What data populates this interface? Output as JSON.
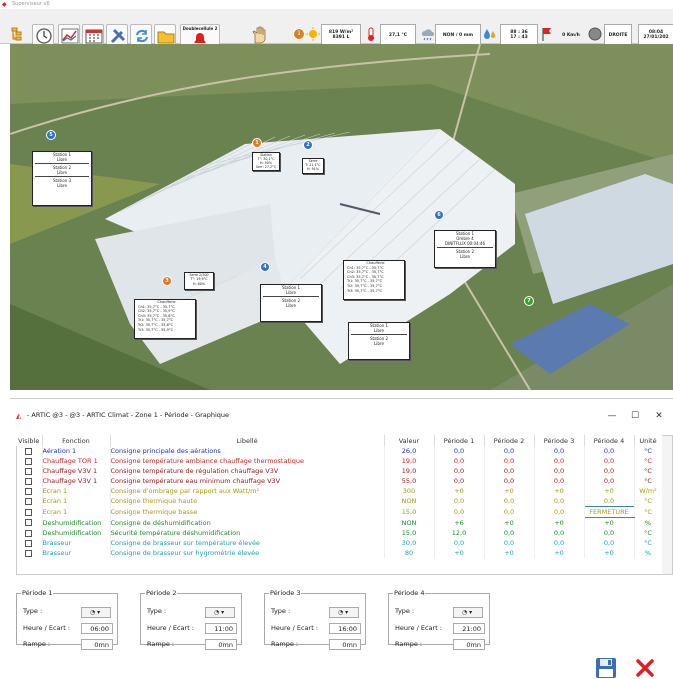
{
  "top_window": {
    "title": "Superviseur v6"
  },
  "toolbar": {
    "alarm_label": "Doublecellule 2",
    "weather": {
      "radiation": "819 W/m²\n8391 L",
      "temperature": "27,1 °C",
      "rain": "NON / 0 mm",
      "humidity": "88 : 36\n17 : 43",
      "wind_speed": "0 Km/h",
      "wind_dir": "DROITE",
      "datetime": "08:04\n27/01/202"
    }
  },
  "map": {
    "pins": [
      {
        "num": "5",
        "color": "#2f6fd0"
      },
      {
        "num": "1",
        "color": "#e07b1b"
      },
      {
        "num": "2",
        "color": "#2f6fd0"
      },
      {
        "num": "6",
        "color": "#2f6fd0"
      },
      {
        "num": "4",
        "color": "#2f6fd0"
      },
      {
        "num": "3",
        "color": "#e07b1b"
      },
      {
        "num": "7",
        "color": "#3aa02a"
      }
    ],
    "boxes": [
      {
        "lines": [
          "Station 1",
          "Libre",
          "",
          "Station 2",
          "Libre",
          "",
          "Station 3",
          "Libre"
        ]
      },
      {
        "lines": [
          "Station",
          "T°: 20,1°C",
          "H: 90%",
          "Serr: 27,2°C"
        ]
      },
      {
        "lines": [
          "Serre",
          "T: 21,1°C",
          "H: 91%"
        ]
      },
      {
        "lines": [
          "Station 1",
          "Ombre 4",
          "DINITFLUX 00:04:46",
          "",
          "Station 2",
          "Libre"
        ]
      },
      {
        "lines": [
          "Chaufferie",
          "Ch1: 35,7°C - 35,7°C",
          "Ch2: 35,7°C - 35,7°C",
          "Ch3: 35,7°C - 35,7°C",
          "Tr1: 35,7°C - 35,7°C",
          "Tr2: 35,7°C - 35,7°C",
          "Tr3: 35,7°C - 35,7°C"
        ]
      },
      {
        "lines": [
          "Station 1",
          "Libre",
          "",
          "Station 2",
          "Libre"
        ]
      },
      {
        "lines": [
          "Serre 2/300",
          "T°: 19,9°C",
          "H: 80%"
        ]
      },
      {
        "lines": [
          "Chaufferie",
          "Ch1: 35,7°C - 35,7°C",
          "Ch2: 35,7°C - 35,9°C",
          "Ch3: 35,7°C - 35,8°C",
          "Tr1: 35,7°C - 35,7°C",
          "Tr2: 35,7°C - 35,8°C",
          "Tr3: 35,7°C - 35,9°C"
        ]
      },
      {
        "lines": [
          "Station 1",
          "Libre",
          "",
          "Station 2",
          "Libre"
        ]
      }
    ]
  },
  "dialog": {
    "title": "- ARTIC @3 - @3 - ARTIC Climat - Zone 1 - Période - Graphique",
    "buttons": {
      "minimize": "—",
      "maximize": "☐",
      "close": "✕"
    },
    "columns": [
      "Visible",
      "Fonction",
      "Libellé",
      "Valeur",
      "Période 1",
      "Période 2",
      "Période 3",
      "Période 4",
      "Unité"
    ],
    "rows": [
      {
        "fonction": "Aération 1",
        "libelle": "Consigne principale des aérations",
        "valeur": "26,0",
        "p1": "0,0",
        "p2": "0,0",
        "p3": "0,0",
        "p4": "0,0",
        "unite": "°C",
        "color": "#1a2fd8"
      },
      {
        "fonction": "Chauffage TOR 1",
        "libelle": "Consigne température ambiance chauffage thermostatique",
        "valeur": "19,0",
        "p1": "0,0",
        "p2": "0,0",
        "p3": "0,0",
        "p4": "0,0",
        "unite": "°C",
        "color": "#d81a1a"
      },
      {
        "fonction": "Chauffage V3V 1",
        "libelle": "Consigne température de régulation chauffage V3V",
        "valeur": "19,0",
        "p1": "0,0",
        "p2": "0,0",
        "p3": "0,0",
        "p4": "0,0",
        "unite": "°C",
        "color": "#a01818"
      },
      {
        "fonction": "Chauffage V3V 1",
        "libelle": "Consigne température eau minimum chauffage V3V",
        "valeur": "55,0",
        "p1": "0,0",
        "p2": "0,0",
        "p3": "0,0",
        "p4": "0,0",
        "unite": "°C",
        "color": "#a01818"
      },
      {
        "fonction": "Ecran 1",
        "libelle": "Consigne d'ombrage par rapport aux Watt/m²",
        "valeur": "300",
        "p1": "+0",
        "p2": "+0",
        "p3": "+0",
        "p4": "+0",
        "unite": "W/m²",
        "color": "#a89a10"
      },
      {
        "fonction": "Ecran 1",
        "libelle": "Consigne thermique haute",
        "valeur": "NON",
        "p1": "0,0",
        "p2": "0,0",
        "p3": "0,0",
        "p4": "0,0",
        "unite": "°C",
        "color": "#a89a10"
      },
      {
        "fonction": "Ecran 1",
        "libelle": "Consigne thermique basse",
        "valeur": "15,0",
        "p1": "0,0",
        "p2": "0,0",
        "p3": "0,0",
        "p4": "FERMETURE",
        "unite": "°C",
        "color": "#a89a10"
      },
      {
        "fonction": "Deshumidification",
        "libelle": "Consigne de déshumidification",
        "valeur": "NON",
        "p1": "+6",
        "p2": "+0",
        "p3": "+0",
        "p4": "+0",
        "unite": "%",
        "color": "#1b8a2a"
      },
      {
        "fonction": "Deshumidification",
        "libelle": "Sécurité température déshumidification",
        "valeur": "15,0",
        "p1": "12,0",
        "p2": "0,0",
        "p3": "0,0",
        "p4": "0,0",
        "unite": "°C",
        "color": "#1b8a2a"
      },
      {
        "fonction": "Brasseur",
        "libelle": "Consigne de brasseur sur température élevée",
        "valeur": "30,0",
        "p1": "0,0",
        "p2": "0,0",
        "p3": "0,0",
        "p4": "0,0",
        "unite": "°C",
        "color": "#1aa0b8"
      },
      {
        "fonction": "Brasseur",
        "libelle": "Consigne de brasseur sur hygrométrie élevée",
        "valeur": "80",
        "p1": "+0",
        "p2": "+0",
        "p3": "+0",
        "p4": "+0",
        "unite": "%",
        "color": "#1aa0b8"
      }
    ],
    "periods": [
      {
        "legend": "Période 1",
        "type_label": "Type :",
        "heure_label": "Heure / Ecart :",
        "heure": "06:00",
        "rampe_label": "Rampe :",
        "rampe": "0mn"
      },
      {
        "legend": "Période 2",
        "type_label": "Type :",
        "heure_label": "Heure / Ecart :",
        "heure": "11:00",
        "rampe_label": "Rampe :",
        "rampe": "0mn"
      },
      {
        "legend": "Période 3",
        "type_label": "Type :",
        "heure_label": "Heure / Ecart :",
        "heure": "16:00",
        "rampe_label": "Rampe :",
        "rampe": "0mn"
      },
      {
        "legend": "Période 4",
        "type_label": "Type :",
        "heure_label": "Heure / Ecart :",
        "heure": "21:00",
        "rampe_label": "Rampe :",
        "rampe": "0mn"
      }
    ]
  }
}
